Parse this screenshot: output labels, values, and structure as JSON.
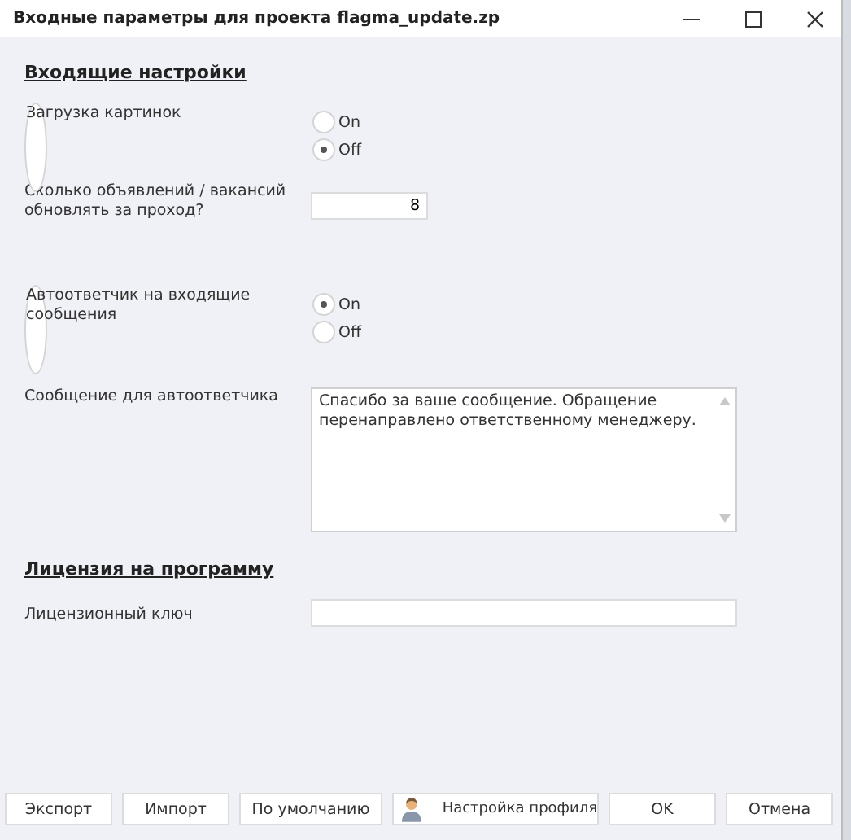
{
  "window": {
    "title": "Входные параметры для проекта flagma_update.zp"
  },
  "sections": [
    {
      "heading": "Входящие настройки",
      "fields": [
        {
          "kind": "radio",
          "label": "Загрузка картинок",
          "options": [
            {
              "label": "On",
              "selected": false
            },
            {
              "label": "Off",
              "selected": true
            }
          ]
        },
        {
          "kind": "number",
          "label": "Сколько объявлений / вакансий обновлять за проход?",
          "value": "8"
        },
        {
          "kind": "radio",
          "label": "Автоответчик на входящие сообщения",
          "options": [
            {
              "label": "On",
              "selected": true
            },
            {
              "label": "Off",
              "selected": false
            }
          ]
        },
        {
          "kind": "textarea",
          "label": "Сообщение для автоответчика",
          "value": "Спасибо за ваше сообщение. Обращение перенаправлено ответственному менеджеру."
        }
      ]
    },
    {
      "heading": "Лицензия на программу",
      "fields": [
        {
          "kind": "text",
          "label": "Лицензионный ключ"
        }
      ]
    }
  ],
  "buttons": [
    {
      "label": "Экспорт",
      "kind": "plain"
    },
    {
      "label": "Импорт",
      "kind": "plain"
    },
    {
      "label": "По умолчанию",
      "kind": "plain"
    },
    {
      "label": "Настройка профиля",
      "kind": "person"
    },
    {
      "label": "OK",
      "kind": "plain"
    },
    {
      "label": "Отмена",
      "kind": "plain"
    }
  ]
}
